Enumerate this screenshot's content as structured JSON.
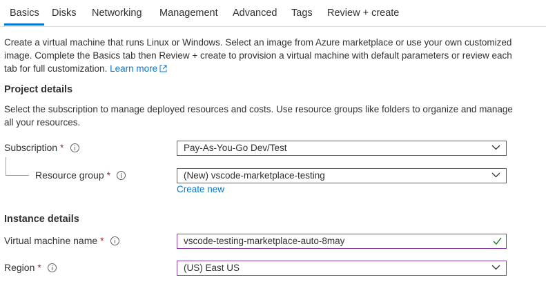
{
  "tabs": [
    {
      "label": "Basics",
      "active": true
    },
    {
      "label": "Disks"
    },
    {
      "label": "Networking"
    },
    {
      "label": "Management"
    },
    {
      "label": "Advanced"
    },
    {
      "label": "Tags"
    },
    {
      "label": "Review + create"
    }
  ],
  "intro": {
    "text": "Create a virtual machine that runs Linux or Windows. Select an image from Azure marketplace or use your own customized image. Complete the Basics tab then Review + create to provision a virtual machine with default parameters or review each tab for full customization.",
    "learn_more": "Learn more"
  },
  "project": {
    "title": "Project details",
    "description": "Select the subscription to manage deployed resources and costs. Use resource groups like folders to organize and manage all your resources.",
    "subscription": {
      "label": "Subscription",
      "required": "*",
      "value": "Pay-As-You-Go Dev/Test"
    },
    "resource_group": {
      "label": "Resource group",
      "required": "*",
      "value": "(New) vscode-marketplace-testing",
      "create_new": "Create new"
    }
  },
  "instance": {
    "title": "Instance details",
    "vm_name": {
      "label": "Virtual machine name",
      "required": "*",
      "value": "vscode-testing-marketplace-auto-8may"
    },
    "region": {
      "label": "Region",
      "required": "*",
      "value": "(US) East US"
    }
  },
  "colors": {
    "accent": "#0078d4",
    "required": "#a4262c",
    "focus_border": "#8a3ea8",
    "valid": "#107c10"
  },
  "icons": [
    "external-link-icon",
    "info-icon",
    "chevron-down-icon",
    "checkmark-icon"
  ]
}
